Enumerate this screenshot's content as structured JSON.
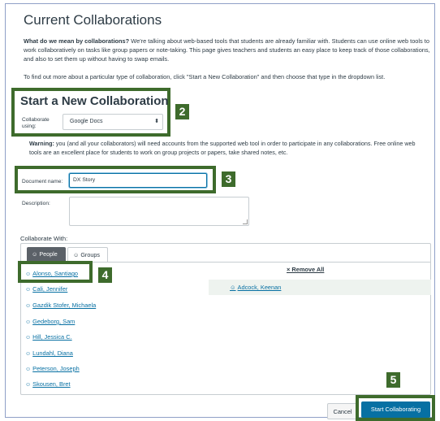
{
  "page": {
    "title": "Current Collaborations",
    "intro_bold": "What do we mean by collaborations?",
    "intro_text": " We're talking about web-based tools that students are already familiar with. Students can use online web tools to work collaboratively on tasks like group papers or note-taking. This page gives teachers and students an easy place to keep track of those collaborations, and also to set them up without having to swap emails.",
    "intro2": "To find out more about a particular type of collaboration, click \"Start a New Collaboration\" and then choose that type in the dropdown list."
  },
  "form": {
    "section_title": "Start a New Collaboration",
    "collaborate_using_label": "Collaborate using:",
    "collaborate_using_value": "Google Docs",
    "warning_bold": "Warning:",
    "warning_text": " you (and all your collaborators) will need accounts from the supported web tool in order to participate in any collaborations. Free online web tools are an excellent place for students to work on group projects or papers, take shared notes, etc.",
    "document_name_label": "Document name:",
    "document_name_value": "DX Story",
    "description_label": "Description:",
    "collaborate_with_label": "Collaborate With:"
  },
  "tabs": {
    "people": "People",
    "groups": "Groups"
  },
  "remove_all": "× Remove All",
  "people": [
    "Alonso, Santiago",
    "Cali, Jennifer",
    "Gazdik Stofer, Michaela",
    "Gedeborg, Sam",
    "Hill, Jessica C.",
    "Lundahl, Diana",
    "Peterson, Joseph",
    "Skousen, Bret"
  ],
  "selected": [
    "Adcock, Keenan"
  ],
  "buttons": {
    "cancel": "Cancel",
    "start": "Start Collaborating"
  },
  "callouts": {
    "c2": "2",
    "c3": "3",
    "c4": "4",
    "c5": "5"
  },
  "colors": {
    "callout_green": "#3e6b2c",
    "link_blue": "#0770a3",
    "primary_button": "#0770a3"
  },
  "icons": {
    "person": "person-icon",
    "groups": "groups-icon",
    "dropdown": "chevron-down-icon"
  }
}
